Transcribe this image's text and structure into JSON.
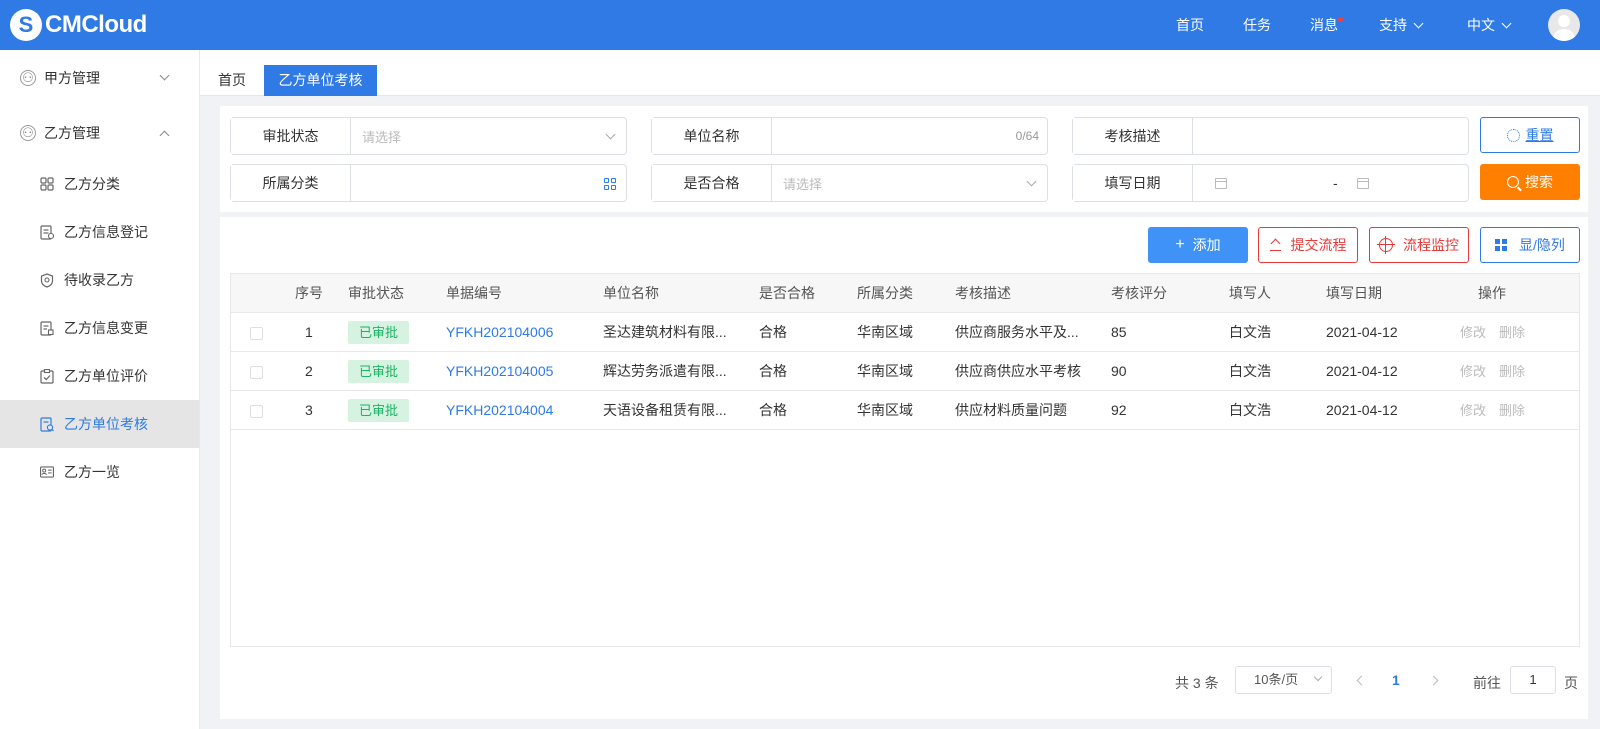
{
  "header": {
    "logo": "CMCloud",
    "nav": [
      "首页",
      "任务",
      "消息",
      "支持",
      "中文"
    ]
  },
  "sidebar": {
    "groups": [
      {
        "label": "甲方管理",
        "expanded": false
      },
      {
        "label": "乙方管理",
        "expanded": true
      }
    ],
    "items": [
      {
        "label": "乙方分类",
        "icon": "grid-icon"
      },
      {
        "label": "乙方信息登记",
        "icon": "document-icon"
      },
      {
        "label": "待收录乙方",
        "icon": "shield-icon"
      },
      {
        "label": "乙方信息变更",
        "icon": "document-edit-icon"
      },
      {
        "label": "乙方单位评价",
        "icon": "clipboard-check-icon"
      },
      {
        "label": "乙方单位考核",
        "icon": "document-search-icon",
        "active": true
      },
      {
        "label": "乙方一览",
        "icon": "id-card-icon"
      }
    ]
  },
  "tabs": [
    "首页",
    "乙方单位考核"
  ],
  "filters": {
    "approval_status": {
      "label": "审批状态",
      "placeholder": "请选择"
    },
    "unit_name": {
      "label": "单位名称",
      "counter": "0/64"
    },
    "assess_desc": {
      "label": "考核描述"
    },
    "category": {
      "label": "所属分类"
    },
    "qualified": {
      "label": "是否合格",
      "placeholder": "请选择"
    },
    "fill_date": {
      "label": "填写日期",
      "separator": "-"
    },
    "reset": "重置",
    "search": "搜索"
  },
  "actions": {
    "add": "添加",
    "submit_flow": "提交流程",
    "flow_monitor": "流程监控",
    "toggle_columns": "显/隐列"
  },
  "table": {
    "headers": [
      "序号",
      "审批状态",
      "单据编号",
      "单位名称",
      "是否合格",
      "所属分类",
      "考核描述",
      "考核评分",
      "填写人",
      "填写日期",
      "操作"
    ],
    "rows": [
      {
        "no": "1",
        "status": "已审批",
        "code": "YFKH202104006",
        "unit": "圣达建筑材料有限...",
        "qualified": "合格",
        "category": "华南区域",
        "desc": "供应商服务水平及...",
        "score": "85",
        "filler": "白文浩",
        "date": "2021-04-12",
        "edit": "修改",
        "delete": "删除"
      },
      {
        "no": "2",
        "status": "已审批",
        "code": "YFKH202104005",
        "unit": "辉达劳务派遣有限...",
        "qualified": "合格",
        "category": "华南区域",
        "desc": "供应商供应水平考核",
        "score": "90",
        "filler": "白文浩",
        "date": "2021-04-12",
        "edit": "修改",
        "delete": "删除"
      },
      {
        "no": "3",
        "status": "已审批",
        "code": "YFKH202104004",
        "unit": "天语设备租赁有限...",
        "qualified": "合格",
        "category": "华南区域",
        "desc": "供应材料质量问题",
        "score": "92",
        "filler": "白文浩",
        "date": "2021-04-12",
        "edit": "修改",
        "delete": "删除"
      }
    ]
  },
  "pagination": {
    "total": "共 3 条",
    "page_size": "10条/页",
    "current": "1",
    "goto_label": "前往",
    "goto_value": "1",
    "page_suffix": "页"
  },
  "colors": {
    "brand": "#2f7ae5",
    "search": "#ff8000",
    "danger": "#e83a3a",
    "approved_bg": "#d6f3e1",
    "approved_text": "#1bb264"
  }
}
